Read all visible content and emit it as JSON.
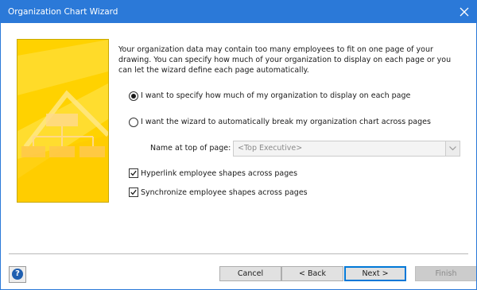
{
  "window": {
    "title": "Organization Chart Wizard",
    "accent_color": "#2b79d8",
    "close_icon": "close-icon"
  },
  "artwork": {
    "description_icon": "org-chart-illustration",
    "colors": [
      "#ffd400",
      "#ffe84a",
      "#ffcc00"
    ]
  },
  "main": {
    "description": "Your organization data may contain too many employees to fit on one page of your drawing.  You can specify how much of your organization to display on each page or you can let the wizard define each page automatically.",
    "options": [
      {
        "label": "I want to specify how much of my organization to display on each page",
        "selected": true
      },
      {
        "label": "I want the wizard to automatically break my organization chart across pages",
        "selected": false
      }
    ],
    "name_at_top": {
      "label": "Name at top of page:",
      "value": "<Top Executive>",
      "enabled": false
    },
    "checkboxes": [
      {
        "label": "Hyperlink employee shapes across pages",
        "checked": true
      },
      {
        "label": "Synchronize employee shapes across pages",
        "checked": true
      }
    ]
  },
  "footer": {
    "help_label": "?",
    "cancel_label": "Cancel",
    "back_label": "< Back",
    "next_label": "Next >",
    "finish_label": "Finish"
  }
}
